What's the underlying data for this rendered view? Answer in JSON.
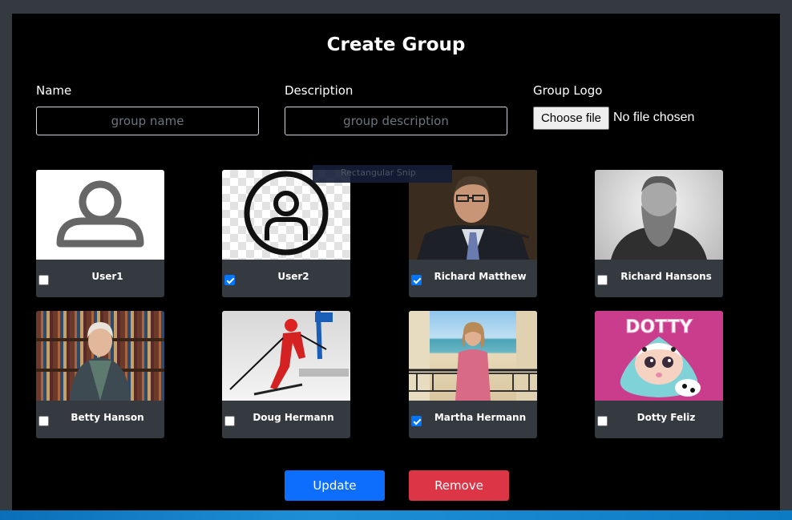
{
  "title": "Create Group",
  "fields": {
    "name": {
      "label": "Name",
      "placeholder": "group name"
    },
    "description": {
      "label": "Description",
      "placeholder": "group description"
    },
    "logo": {
      "label": "Group Logo",
      "button": "Choose file",
      "status": "No file chosen"
    }
  },
  "users": [
    {
      "name": "User1",
      "checked": false,
      "image": "user-outline-avatar"
    },
    {
      "name": "User2",
      "checked": true,
      "image": "user-circle-avatar"
    },
    {
      "name": "Richard Matthew",
      "checked": true,
      "image": "photo-man-speaking"
    },
    {
      "name": "Richard Hansons",
      "checked": false,
      "image": "photo-bearded-man-portrait"
    },
    {
      "name": "Betty Hanson",
      "checked": false,
      "image": "photo-woman-bookshelf"
    },
    {
      "name": "Doug Hermann",
      "checked": false,
      "image": "photo-skier"
    },
    {
      "name": "Martha Hermann",
      "checked": true,
      "image": "photo-woman-balcony"
    },
    {
      "name": "Dotty Feliz",
      "checked": false,
      "image": "cartoon-doll-dotty"
    }
  ],
  "dotty_text": "DOTTY",
  "overlay_text": "Rectangular Snip",
  "buttons": {
    "update": "Update",
    "remove": "Remove"
  },
  "colors": {
    "update": "#0d6efd",
    "remove": "#dc3545",
    "card": "#343a40",
    "checkbox": "#0075ff"
  }
}
